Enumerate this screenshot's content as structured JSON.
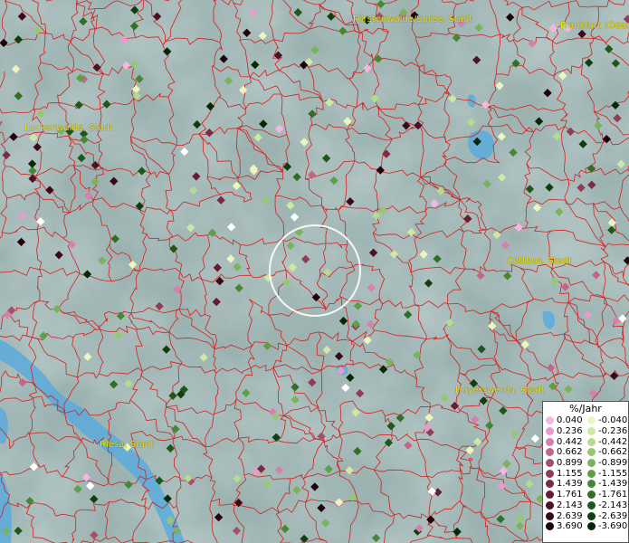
{
  "map": {
    "cities": [
      {
        "name": "Fürstenwalde/Spree, Stadt"
      },
      {
        "name": "Frankfurt (Oder)"
      },
      {
        "name": "Luckenwalde, Stadt"
      },
      {
        "name": "Cottbus, Stadt"
      },
      {
        "name": "Hoyerswerda, Stadt"
      },
      {
        "name": "Riesa, Stadt"
      }
    ]
  },
  "legend": {
    "title": "%/Jahr",
    "positive": [
      {
        "label": "0.040",
        "color": "#f4b8e0"
      },
      {
        "label": "0.236",
        "color": "#e89ccc"
      },
      {
        "label": "0.442",
        "color": "#d680ae"
      },
      {
        "label": "0.662",
        "color": "#c06688"
      },
      {
        "label": "0.899",
        "color": "#a84e6c"
      },
      {
        "label": "1.155",
        "color": "#933a55"
      },
      {
        "label": "1.439",
        "color": "#7d2a43"
      },
      {
        "label": "1.761",
        "color": "#661c32"
      },
      {
        "label": "2.143",
        "color": "#4f1024"
      },
      {
        "label": "2.639",
        "color": "#3a0818"
      },
      {
        "label": "3.690",
        "color": "#20020a"
      }
    ],
    "negative": [
      {
        "label": "-0.040",
        "color": "#eef6c0"
      },
      {
        "label": "-0.236",
        "color": "#cfe9a4"
      },
      {
        "label": "-0.442",
        "color": "#b3dc8c"
      },
      {
        "label": "-0.662",
        "color": "#96c874"
      },
      {
        "label": "-0.899",
        "color": "#79b45c"
      },
      {
        "label": "-1.155",
        "color": "#5e9e46"
      },
      {
        "label": "-1.439",
        "color": "#468734"
      },
      {
        "label": "-1.761",
        "color": "#2f6f26"
      },
      {
        "label": "-2.143",
        "color": "#1e5719"
      },
      {
        "label": "-2.639",
        "color": "#103f0e"
      },
      {
        "label": "-3.690",
        "color": "#052806"
      }
    ]
  },
  "colors": {
    "background": "#8fa8a6",
    "boundaries": "#d42020",
    "water": "#5aaadc",
    "city_label": "#f2e600",
    "marker_ring": "#ffffff"
  }
}
